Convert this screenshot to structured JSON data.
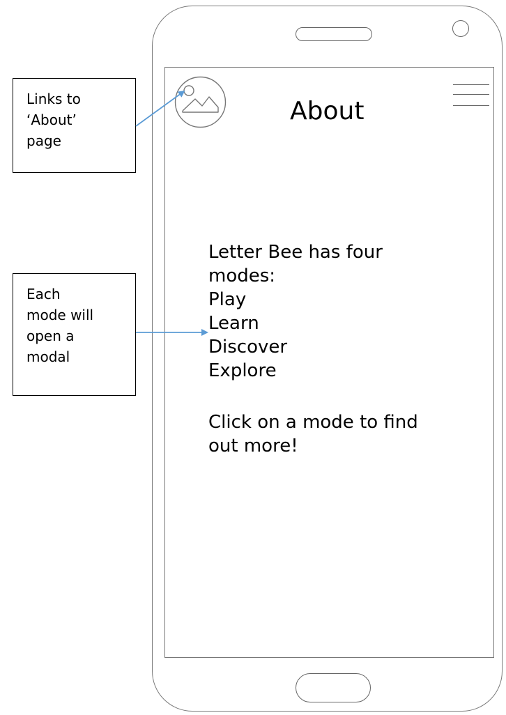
{
  "page": {
    "title": "About"
  },
  "content": {
    "intro_line1": "Letter Bee has four",
    "intro_line2": "modes:",
    "modes": [
      "Play",
      "Learn",
      "Discover",
      "Explore"
    ],
    "cta_line1": "Click on a mode to find",
    "cta_line2": "out more!"
  },
  "annotations": {
    "logo_note": [
      "Links to",
      "‘About’",
      "page"
    ],
    "modes_note": [
      "Each",
      "mode will",
      "open a",
      "modal"
    ]
  },
  "icons": {
    "logo": "image-placeholder-icon",
    "menu": "hamburger-menu-icon"
  },
  "colors": {
    "arrow": "#5b9bd5",
    "outline": "#777777",
    "text": "#000000"
  }
}
